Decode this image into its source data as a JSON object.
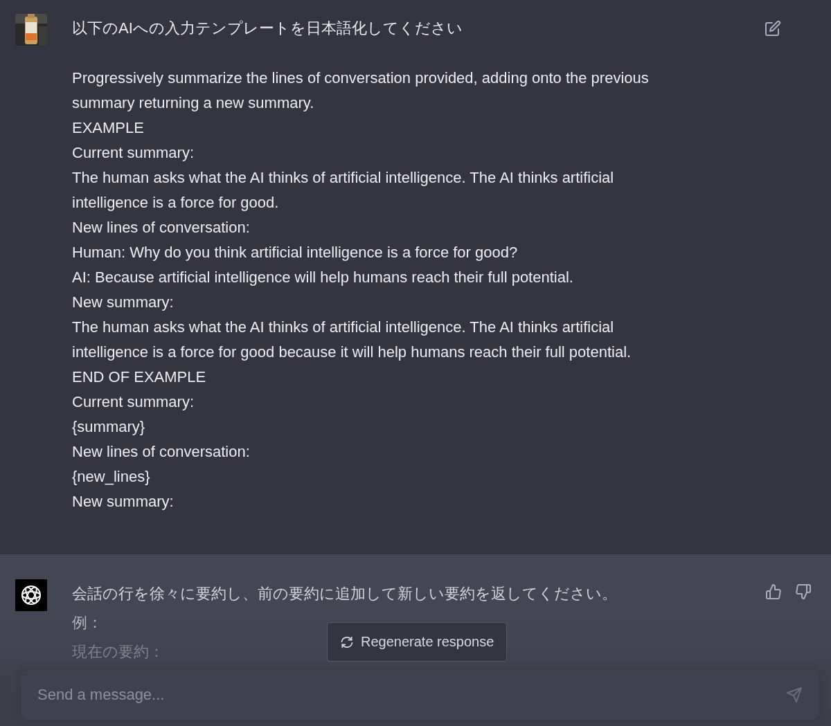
{
  "user_message": {
    "title": "以下のAIへの入力テンプレートを日本語化してください",
    "body": [
      "Progressively summarize the lines of conversation provided, adding onto the previous summary returning a new summary.",
      "EXAMPLE",
      "Current summary:",
      "The human asks what the AI thinks of artificial intelligence. The AI thinks artificial intelligence is a force for good.",
      "New lines of conversation:",
      "Human: Why do you think artificial intelligence is a force for good?",
      "AI: Because artificial intelligence will help humans reach their full potential.",
      "New summary:",
      "The human asks what the AI thinks of artificial intelligence. The AI thinks artificial intelligence is a force for good because it will help humans reach their full potential.",
      "END OF EXAMPLE",
      "Current summary:",
      "{summary}",
      "New lines of conversation:",
      "{new_lines}",
      "New summary:"
    ]
  },
  "assistant_message": {
    "lines": [
      "会話の行を徐々に要約し、前の要約に追加して新しい要約を返してください。",
      "例：",
      "現在の要約："
    ]
  },
  "regenerate_button": {
    "label": "Regenerate response"
  },
  "composer": {
    "placeholder": "Send a message..."
  }
}
